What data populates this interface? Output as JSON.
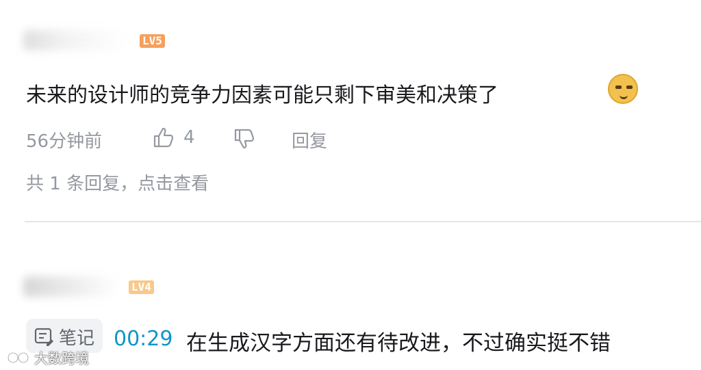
{
  "comment1": {
    "level_badge": "LV5",
    "text": "未来的设计师的竞争力因素可能只剩下审美和决策了",
    "emoji_icon": "doge-emoji-icon",
    "time": "56分钟前",
    "like_count": "4",
    "reply_label": "回复",
    "replies_summary": "共 1 条回复，点击查看"
  },
  "comment2": {
    "level_badge": "LV4",
    "note_label": "笔记",
    "timestamp": "00:29",
    "text": "在生成汉字方面还有待改进，不过确实挺不错"
  },
  "watermark": "大数跨境",
  "colors": {
    "lv5": "#f6a05d",
    "lv4": "#f7c98a",
    "timestamp": "#0e95c9",
    "meta": "#9499a0"
  }
}
